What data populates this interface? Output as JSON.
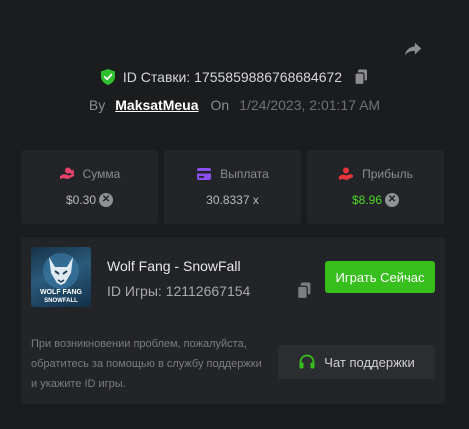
{
  "bet": {
    "id_label": "ID Ставки:",
    "id_value": "1755859886768684672",
    "by_label": "By",
    "user": "MaksatMeua",
    "on_label": "On",
    "datetime": "1/24/2023, 2:01:17 AM"
  },
  "stats": {
    "amount": {
      "label": "Сумма",
      "value": "$0.30",
      "icon": "coins-hand-icon",
      "coin_icon": "currency-x-icon"
    },
    "payout": {
      "label": "Выплата",
      "value": "30.8337 x",
      "icon": "card-icon"
    },
    "profit": {
      "label": "Прибыль",
      "value": "$8.96",
      "icon": "profit-hand-icon",
      "coin_icon": "currency-x-icon"
    }
  },
  "game": {
    "title": "Wolf Fang - SnowFall",
    "id_label": "ID Игры:",
    "id_value": "12112667154",
    "thumb_text_1": "WOLF FANG",
    "thumb_text_2": "SNOWFALL",
    "play_label": "Играть Сейчас"
  },
  "help": {
    "text": "При возникновении проблем, пожалуйста, обратитесь за помощью в службу поддержки и укажите ID игры.",
    "support_label": "Чат поддержки"
  },
  "colors": {
    "accent_green": "#37c01d",
    "profit_green": "#4ad82a",
    "shield_green": "#2fbf2f",
    "pink_icon": "#e8456c",
    "purple_icon": "#8a4ff0",
    "red_icon": "#e8343b"
  }
}
